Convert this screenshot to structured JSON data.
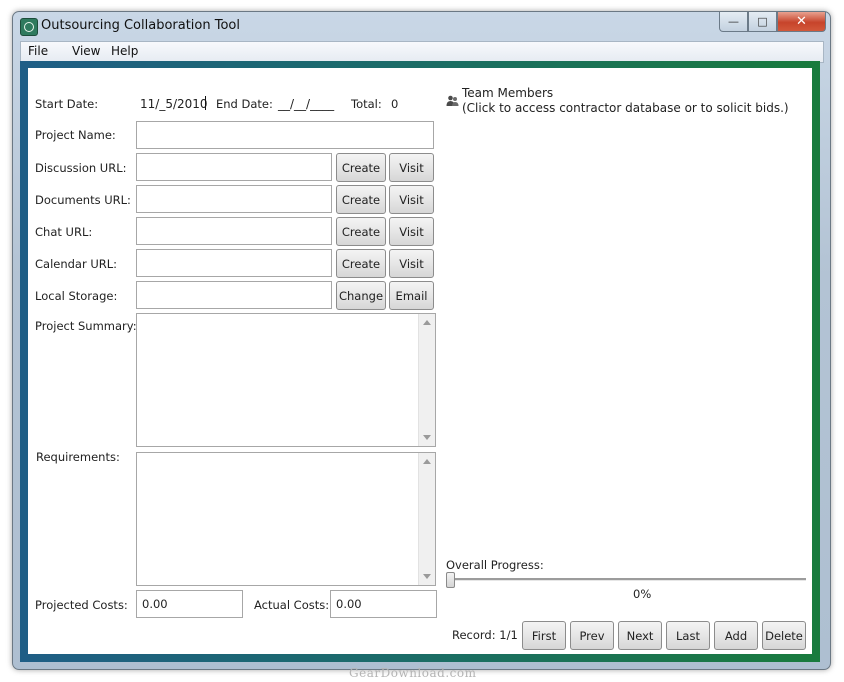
{
  "window": {
    "title": "Outsourcing Collaboration Tool"
  },
  "menu": {
    "items": [
      "File",
      "View",
      "Help"
    ]
  },
  "form": {
    "start_date_label": "Start Date:",
    "start_date_value": "11/_5/2010",
    "end_date_label": "End Date:",
    "end_date_value": "__/__/____",
    "total_label": "Total:",
    "total_value": "0",
    "project_name_label": "Project Name:",
    "project_name_value": "",
    "discussion_url_label": "Discussion URL:",
    "documents_url_label": "Documents URL:",
    "chat_url_label": "Chat URL:",
    "calendar_url_label": "Calendar URL:",
    "local_storage_label": "Local Storage:",
    "create_label": "Create",
    "visit_label": "Visit",
    "change_label": "Change",
    "email_label": "Email",
    "project_summary_label": "Project Summary:",
    "requirements_label": "Requirements:",
    "projected_costs_label": "Projected Costs:",
    "projected_costs_value": "0.00",
    "actual_costs_label": "Actual Costs:",
    "actual_costs_value": "0.00"
  },
  "team": {
    "title": "Team Members",
    "hint": "(Click to access contractor database or to solicit bids.)",
    "icon": "people-icon"
  },
  "progress": {
    "label": "Overall Progress:",
    "value": 0,
    "display": "0%"
  },
  "nav": {
    "record_label": "Record: 1/1",
    "first": "First",
    "prev": "Prev",
    "next": "Next",
    "last": "Last",
    "add": "Add",
    "delete": "Delete"
  },
  "watermark": "GearDownload.com"
}
